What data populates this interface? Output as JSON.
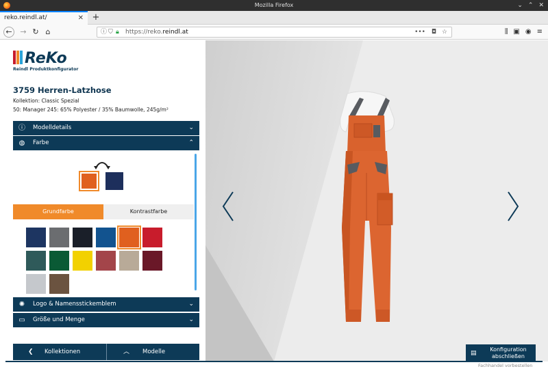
{
  "window": {
    "title": "Mozilla Firefox"
  },
  "browser": {
    "tab_title": "reko.reindl.at/",
    "url_prefix": "https://reko.",
    "url_domain": "reindl.at"
  },
  "logo": {
    "brand": "ReKo",
    "tagline": "Reindl Produktkonfigurator"
  },
  "product": {
    "title": "3759 Herren-Latzhose",
    "collection": "Kollektion: Classic Spezial",
    "material": "50: Manager 245: 65% Polyester / 35% Baumwolle, 245g/m²"
  },
  "accordion": {
    "modelldetails": "Modelldetails",
    "farbe": "Farbe",
    "logo": "Logo & Namensstickemblem",
    "groesse": "Größe und Menge"
  },
  "color_tabs": {
    "grundfarbe": "Grundfarbe",
    "kontrastfarbe": "Kontrastfarbe"
  },
  "selected_colors": {
    "main": "#e0601f",
    "contrast": "#1d2f5c"
  },
  "swatches": [
    {
      "color": "#1d3561"
    },
    {
      "color": "#6b6d70"
    },
    {
      "color": "#1a1f29"
    },
    {
      "color": "#12538f"
    },
    {
      "color": "#e0601f",
      "selected": true
    },
    {
      "color": "#c81c2c"
    },
    {
      "color": "#2f5a5a"
    },
    {
      "color": "#0a5a35"
    },
    {
      "color": "#f2d100"
    },
    {
      "color": "#a3454a"
    },
    {
      "color": "#b8aa98"
    },
    {
      "color": "#6a1828"
    },
    {
      "color": "#c5c8cc"
    },
    {
      "color": "#6b5340"
    }
  ],
  "bottom_nav": {
    "kollektionen": "Kollektionen",
    "modelle": "Modelle"
  },
  "config_button": "Konfiguration abschließen",
  "footer": "Fachhandel vorbestellen",
  "colors": {
    "navy": "#0d3a57",
    "accent": "#f08a2a",
    "title": "#0f3550"
  }
}
